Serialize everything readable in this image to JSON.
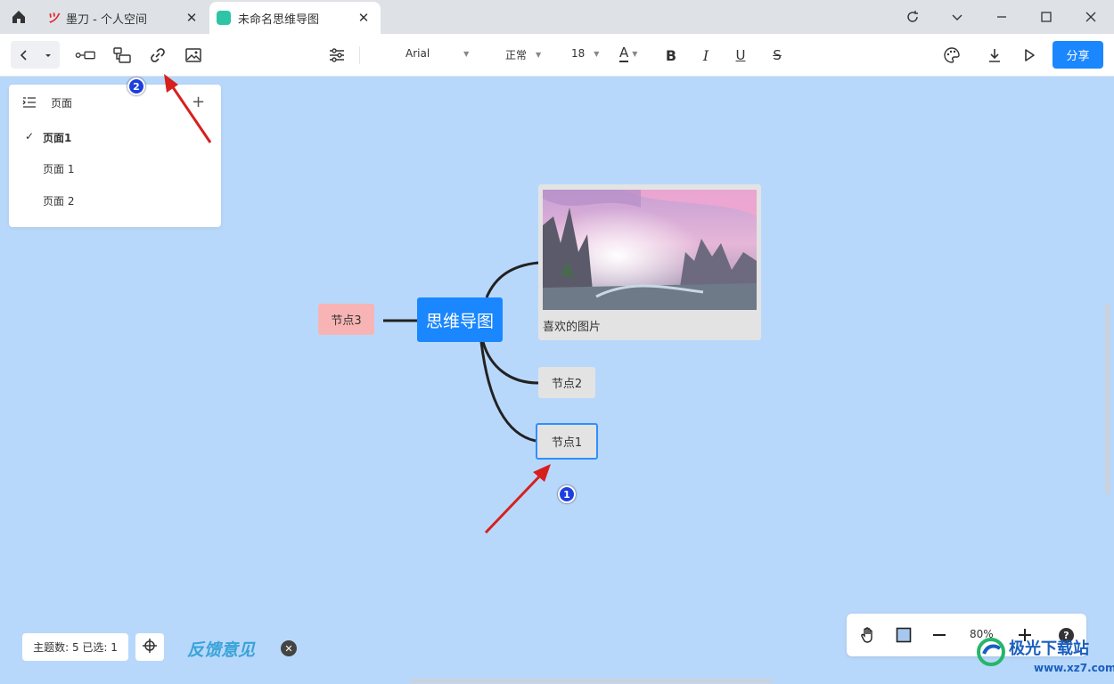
{
  "tabs": [
    {
      "label": "墨刀 - 个人空间",
      "logo": "modao-logo",
      "active": false
    },
    {
      "label": "未命名思维导图",
      "logo": "mindmap-app-icon",
      "active": true
    }
  ],
  "toolbar": {
    "font_family": "Arial",
    "font_weight": "正常",
    "font_size": "18",
    "font_color_label": "A",
    "bold": "B",
    "italic": "I",
    "underline": "U",
    "strike": "S",
    "share_label": "分享"
  },
  "pages_panel": {
    "title": "页面",
    "items": [
      {
        "label": "页面1",
        "selected": true
      },
      {
        "label": "页面 1",
        "selected": false
      },
      {
        "label": "页面 2",
        "selected": false
      }
    ]
  },
  "mindmap": {
    "root": "思维导图",
    "left_node": "节点3",
    "image_caption": "喜欢的图片",
    "node2": "节点2",
    "node1": "节点1"
  },
  "annotations": {
    "badge1": "1",
    "badge2": "2"
  },
  "status": {
    "text": "主题数: 5 已选: 1",
    "feedback": "反馈意见"
  },
  "zoom": {
    "value": "80%"
  },
  "help": "?",
  "watermark": {
    "title": "极光下载站",
    "url": "www.xz7.com"
  },
  "colors": {
    "accent": "#1a87ff",
    "canvas": "#b8d8fb",
    "node3": "#f8b4b4",
    "badge": "#1c3fe0",
    "arrow": "#d6201e"
  }
}
